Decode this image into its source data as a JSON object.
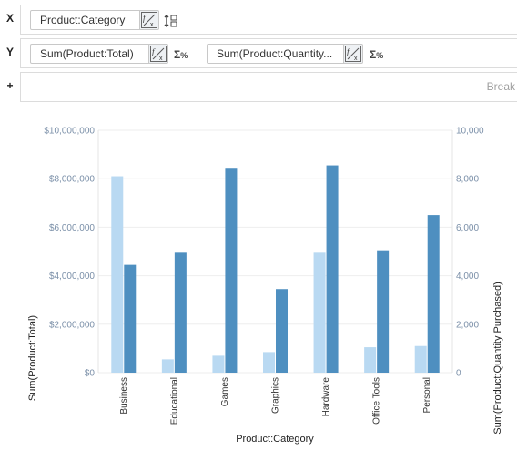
{
  "shelves": {
    "x": {
      "letter": "X",
      "pills": [
        {
          "label": "Product:Category"
        }
      ]
    },
    "y": {
      "letter": "Y",
      "pills": [
        {
          "label": "Sum(Product:Total)"
        },
        {
          "label": "Sum(Product:Quantity..."
        }
      ]
    },
    "plus": {
      "letter": "+",
      "break_label": "Break"
    }
  },
  "icons": {
    "fx": "function-edit-icon",
    "sort": "sort-icon",
    "sigma": "sum-percent-icon"
  },
  "colors": {
    "total": "#b9d9f2",
    "quantity": "#4e8fc0",
    "grid": "#eeeeee",
    "tick": "#7a8fa8"
  },
  "chart_data": {
    "type": "bar",
    "categories": [
      "Business",
      "Educational",
      "Games",
      "Graphics",
      "Hardware",
      "Office Tools",
      "Personal"
    ],
    "series": [
      {
        "name": "Sum(Product:Total)",
        "axis": "left",
        "values": [
          8100000,
          550000,
          700000,
          850000,
          4950000,
          1050000,
          1100000
        ]
      },
      {
        "name": "Sum(Product:Quantity Purchased)",
        "axis": "right",
        "values": [
          4450,
          4950,
          8450,
          3450,
          8550,
          5050,
          6500
        ]
      }
    ],
    "left_axis": {
      "label": "Sum(Product:Total)",
      "ylim": [
        0,
        10000000
      ],
      "ticks": [
        "$0",
        "$2,000,000",
        "$4,000,000",
        "$6,000,000",
        "$8,000,000",
        "$10,000,000"
      ]
    },
    "right_axis": {
      "label": "Sum(Product:Quantity Purchased)",
      "ylim": [
        0,
        10000
      ],
      "ticks": [
        "0",
        "2,000",
        "4,000",
        "6,000",
        "8,000",
        "10,000"
      ]
    },
    "xlabel": "Product:Category",
    "grid": true
  }
}
